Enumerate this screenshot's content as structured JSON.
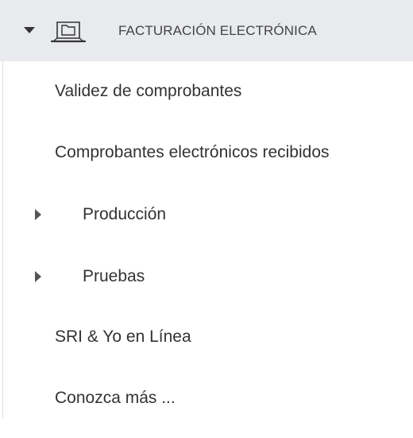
{
  "menu": {
    "header": {
      "label": "FACTURACIÓN ELECTRÓNICA",
      "icon": "laptop-icon",
      "expanded": true
    },
    "items": [
      {
        "label": "Validez de comprobantes",
        "has_submenu": false
      },
      {
        "label": "Comprobantes electrónicos recibidos",
        "has_submenu": false
      },
      {
        "label": "Producción",
        "has_submenu": true,
        "icon": "caret-right-icon"
      },
      {
        "label": "Pruebas",
        "has_submenu": true,
        "icon": "caret-right-icon"
      },
      {
        "label": "SRI & Yo en Línea",
        "has_submenu": false
      },
      {
        "label": "Conozca más ...",
        "has_submenu": false
      }
    ]
  },
  "colors": {
    "header_bg": "#e8eaee",
    "text": "#333333",
    "header_text": "#444444"
  }
}
